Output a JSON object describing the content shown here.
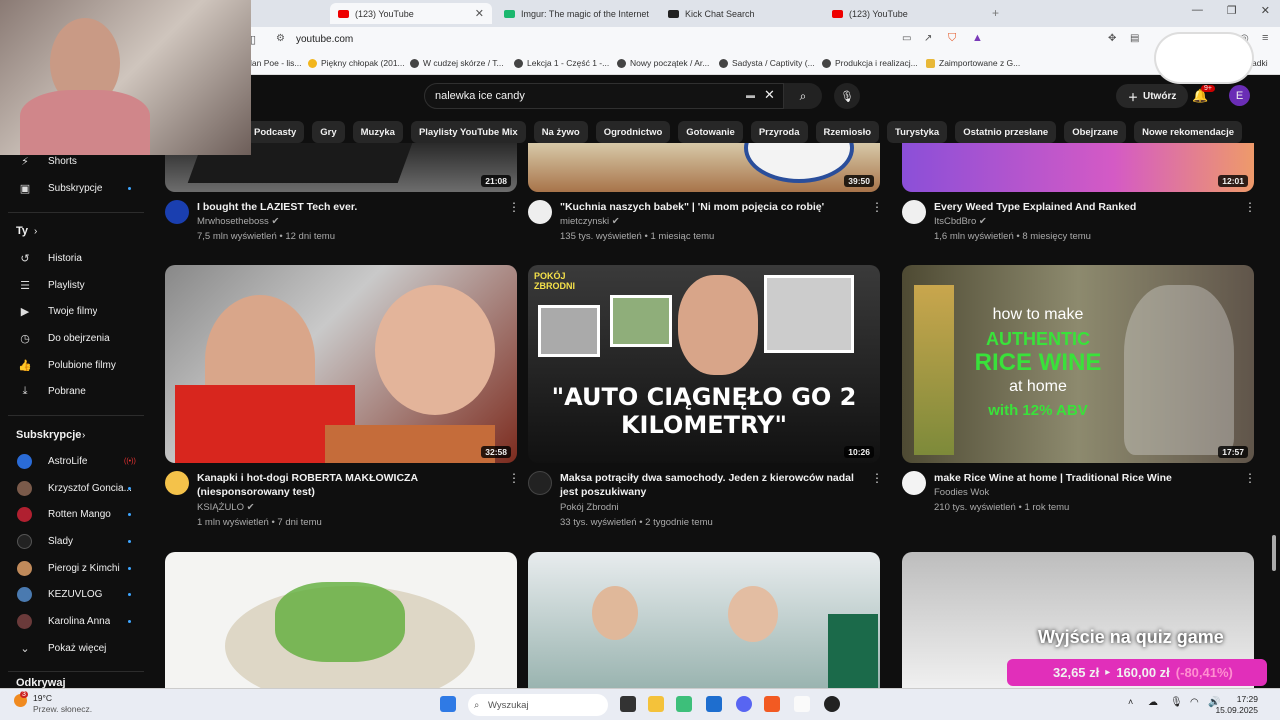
{
  "tabs": [
    {
      "label": "(123) YouTube",
      "active": true
    },
    {
      "label": "Imgur: The magic of the Internet"
    },
    {
      "label": "Kick Chat Search"
    },
    {
      "label": "(123) YouTube"
    }
  ],
  "address": {
    "url": "youtube.com"
  },
  "bookmarks": [
    "lan Poe - lis...",
    "Piękny chłopak (201...",
    "W cudzej skórze / T...",
    "Lekcja 1 - Część 1 -...",
    "Nowy początek / Ar...",
    "Sadysta / Captivity (...",
    "Produkcja i realizacj...",
    "Zaimportowane z G...",
    "adki"
  ],
  "header": {
    "search_value": "nalewka ice candy",
    "create_label": "Utwórz",
    "bell_badge": "9+",
    "avatar_letter": "E"
  },
  "chips": [
    "Podcasty",
    "Gry",
    "Muzyka",
    "Playlisty YouTube Mix",
    "Na żywo",
    "Ogrodnictwo",
    "Gotowanie",
    "Przyroda",
    "Rzemiosło",
    "Turystyka",
    "Ostatnio przesłane",
    "Obejrzane",
    "Nowe rekomendacje"
  ],
  "sidebar": {
    "top": [
      {
        "label": "Shorts"
      },
      {
        "label": "Subskrypcje"
      }
    ],
    "you_header": "Ty",
    "you": [
      {
        "label": "Historia"
      },
      {
        "label": "Playlisty"
      },
      {
        "label": "Twoje filmy"
      },
      {
        "label": "Do obejrzenia"
      },
      {
        "label": "Polubione filmy"
      },
      {
        "label": "Pobrane"
      }
    ],
    "subs_header": "Subskrypcje",
    "subs": [
      {
        "label": "AstroLife",
        "color": "#2a6bd6"
      },
      {
        "label": "Krzysztof Goncia...",
        "color": "#7a5a4a"
      },
      {
        "label": "Rotten Mango",
        "color": "#b02030"
      },
      {
        "label": "Ślady",
        "color": "#222222"
      },
      {
        "label": "Pierogi z Kimchi",
        "color": "#c08a5a"
      },
      {
        "label": "KEZUVLOG",
        "color": "#4a7ab0"
      },
      {
        "label": "Karolina Anna",
        "color": "#6a3a3a"
      }
    ],
    "show_more": "Pokaż więcej",
    "cut_header": "Odkrywaj"
  },
  "videos_row1": [
    {
      "title": "I bought the LAZIEST Tech ever.",
      "channel": "Mrwhosetheboss",
      "meta": "7,5 mln wyświetleń • 12 dni temu",
      "duration": "21:08"
    },
    {
      "title": "\"Kuchnia naszych babek\" | 'Ni mom pojęcia co robię'",
      "channel": "mietczynski",
      "meta": "135 tys. wyświetleń • 1 miesiąc temu",
      "duration": "39:50"
    },
    {
      "title": "Every Weed Type Explained And Ranked",
      "channel": "ItsCbdBro",
      "meta": "1,6 mln wyświetleń • 8 miesięcy temu",
      "duration": "12:01"
    }
  ],
  "videos_row2": [
    {
      "title": "Kanapki i hot-dogi ROBERTA MAKŁOWICZA (niesponsorowany test)",
      "channel": "KSIĄŻULO",
      "meta": "1 mln wyświetleń • 7 dni temu",
      "duration": "32:58"
    },
    {
      "title": "Maksa potrąciły dwa samochody. Jeden z kierowców nadal jest poszukiwany",
      "channel": "Pokój Zbrodni",
      "meta": "33 tys. wyświetleń • 2 tygodnie temu",
      "duration": "10:26",
      "thumb_text": "\"AUTO CIĄGNĘŁO GO 2 KILOMETRY\"",
      "badge": "POKÓJ ZBRODNI"
    },
    {
      "title": "make Rice Wine at home | Traditional Rice Wine",
      "channel": "Foodies Wok",
      "meta": "210 tys. wyświetleń • 1 rok temu",
      "duration": "17:57",
      "thumb_lines": [
        "how to make",
        "AUTHENTIC",
        "RICE WINE",
        "at home",
        "with 12% ABV"
      ]
    }
  ],
  "overlay": {
    "quiz": "Wyjście na quiz game",
    "price_now": "32,65 zł",
    "price_old": "160,00 zł",
    "price_pct": "(-80,41%)"
  },
  "taskbar": {
    "temp": "19°C",
    "weather": "Przew. słonecz.",
    "search": "Wyszukaj",
    "time": "17:29",
    "date": "15.09.2025",
    "weather_badge": "3"
  }
}
